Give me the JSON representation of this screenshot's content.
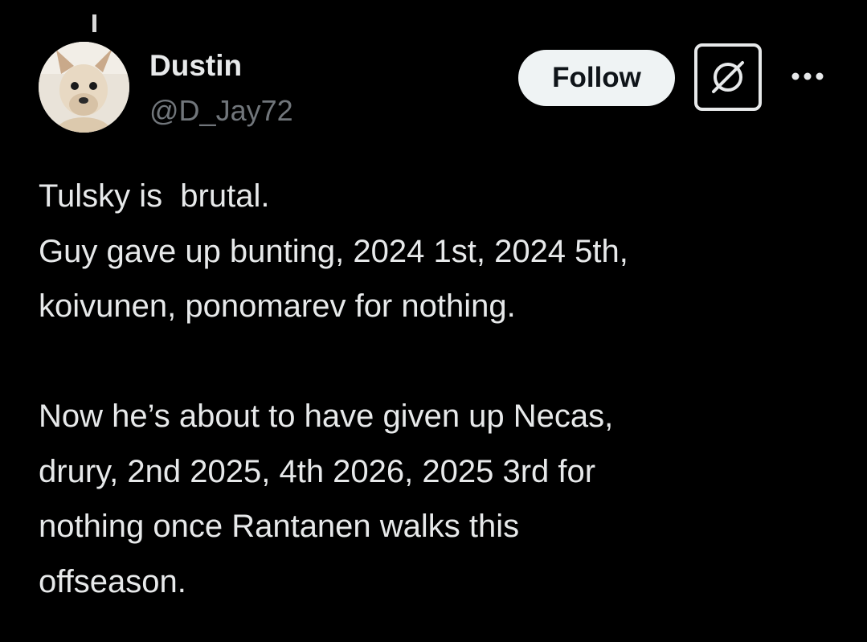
{
  "author": {
    "display_name": "Dustin",
    "handle": "@D_Jay72"
  },
  "actions": {
    "follow_label": "Follow",
    "grok_icon": "grok-icon",
    "more_icon": "more-options-icon"
  },
  "tweet": {
    "paragraphs": [
      [
        "Tulsky is  brutal.",
        "Guy gave up bunting, 2024 1st, 2024 5th,",
        "koivunen, ponomarev for nothing."
      ],
      [
        "Now he’s about to have given up Necas,",
        "drury, 2nd 2025, 4th 2026, 2025 3rd for",
        "nothing once Rantanen walks this",
        "offseason."
      ]
    ]
  },
  "colors": {
    "background": "#000000",
    "text_primary": "#e7e9ea",
    "text_secondary": "#71767b",
    "follow_bg": "#eff3f4"
  }
}
